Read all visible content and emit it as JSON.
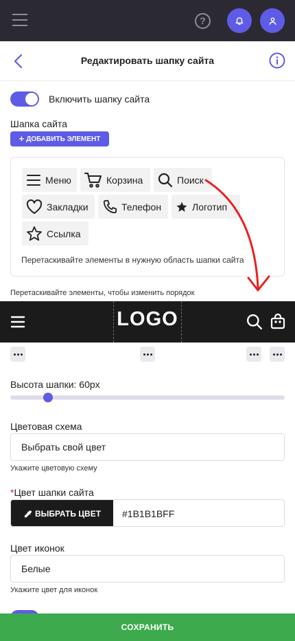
{
  "topbar": {
    "menu_icon": "hamburger-icon",
    "help_icon_glyph": "?",
    "bell_icon": "bell-icon",
    "user_icon": "user-icon"
  },
  "header": {
    "title": "Редактировать шапку сайта"
  },
  "enable_toggle": {
    "label": "Включить шапку сайта",
    "on": true
  },
  "elements_section": {
    "label": "Шапка сайта",
    "add_button": "ДОБАВИТЬ ЭЛЕМЕНТ",
    "add_button_icon": "+",
    "chips": [
      {
        "label": "Меню",
        "icon": "menu-icon"
      },
      {
        "label": "Корзина",
        "icon": "cart-icon"
      },
      {
        "label": "Поиск",
        "icon": "search-icon"
      },
      {
        "label": "Закладки",
        "icon": "heart-icon"
      },
      {
        "label": "Телефон",
        "icon": "phone-icon"
      },
      {
        "label": "Логотип",
        "icon": "star-filled-icon"
      },
      {
        "label": "Ссылка",
        "icon": "star-outline-icon"
      }
    ],
    "drag_hint": "Перетаскивайте элементы в нужную область шапки сайта"
  },
  "preview": {
    "order_hint": "Перетаскивайте элементы, чтобы изменить порядок",
    "logo_text": "LOGO"
  },
  "height_setting": {
    "label": "Высота шапки: 60px",
    "slider_fraction": 0.14
  },
  "color_scheme": {
    "label": "Цветовая схема",
    "value": "Выбрать свой цвет",
    "hint": "Укажите цветовую схему"
  },
  "header_color": {
    "required_mark": "*",
    "label": "Цвет шапки сайта",
    "button": "ВЫБРАТЬ ЦВЕТ",
    "value": "#1B1B1BFF"
  },
  "icon_color": {
    "label": "Цвет иконок",
    "value": "Белые",
    "hint": "Укажите цвет для иконок"
  },
  "footer": {
    "save_button": "СОХРАНИТЬ"
  },
  "colors": {
    "accent": "#5E5CE6",
    "topbar": "#2B2A33",
    "preview_bg": "#1B1B1B",
    "save_bg": "#3CAA4D",
    "annotation_arrow": "#E8201F"
  }
}
